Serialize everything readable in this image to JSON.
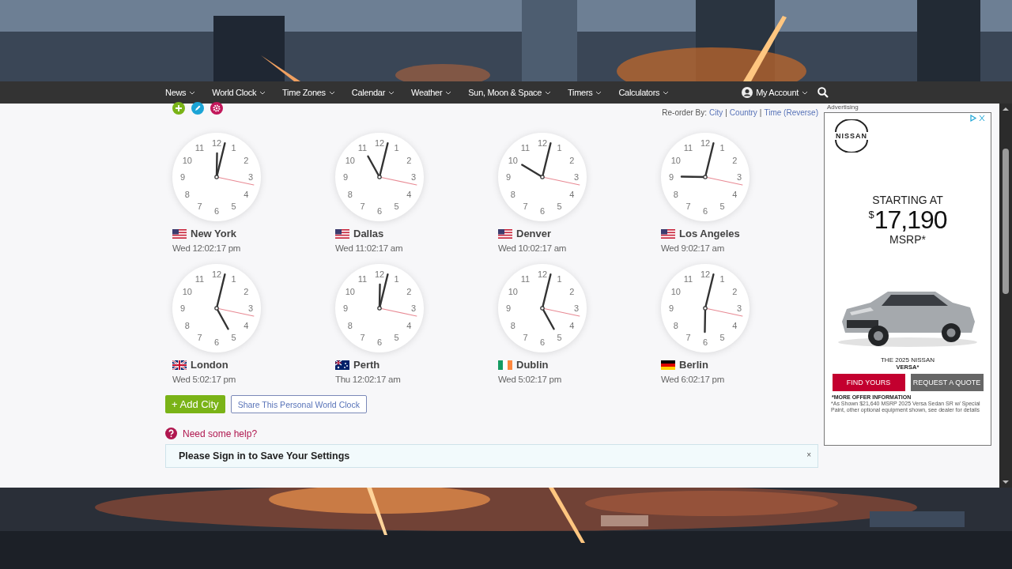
{
  "nav": {
    "items": [
      {
        "label": "News"
      },
      {
        "label": "World Clock"
      },
      {
        "label": "Time Zones"
      },
      {
        "label": "Calendar"
      },
      {
        "label": "Weather"
      },
      {
        "label": "Sun, Moon & Space"
      },
      {
        "label": "Timers"
      },
      {
        "label": "Calculators"
      }
    ],
    "account": "My Account"
  },
  "reorder": {
    "label": "Re-order By:",
    "links": [
      "City",
      "Country",
      "Time (Reverse)"
    ],
    "separator": "|"
  },
  "clocks": [
    {
      "city": "New York",
      "flag": {
        "kind": "us"
      },
      "time": "Wed 12:02:17 pm",
      "dial": [
        "12",
        "11",
        "1",
        "10",
        "2",
        "9",
        "3",
        "8",
        "4",
        "7",
        "5",
        "6"
      ]
    },
    {
      "city": "Dallas",
      "flag": {
        "kind": "us"
      },
      "time": "Wed 11:02:17 am",
      "dial": [
        "12",
        "11",
        "1",
        "10",
        "2",
        "9",
        "3",
        "8",
        "4",
        "7",
        "5",
        "6"
      ]
    },
    {
      "city": "Denver",
      "flag": {
        "kind": "us"
      },
      "time": "Wed 10:02:17 am",
      "dial": [
        "12",
        "11",
        "1",
        "10",
        "2",
        "9",
        "3",
        "8",
        "4",
        "7",
        "5",
        "6"
      ]
    },
    {
      "city": "Los Angeles",
      "flag": {
        "kind": "us"
      },
      "time": "Wed 9:02:17 am",
      "dial": [
        "12",
        "11",
        "1",
        "10",
        "2",
        "9",
        "3",
        "8",
        "4",
        "7",
        "5",
        "6"
      ]
    },
    {
      "city": "London",
      "flag": {
        "kind": "gb"
      },
      "time": "Wed 5:02:17 pm",
      "dial": [
        "12",
        "11",
        "1",
        "10",
        "2",
        "9",
        "3",
        "8",
        "4",
        "7",
        "5",
        "6"
      ]
    },
    {
      "city": "Perth",
      "flag": {
        "kind": "au"
      },
      "time": "Thu 12:02:17 am",
      "dial": [
        "12",
        "11",
        "1",
        "10",
        "2",
        "9",
        "3",
        "8",
        "4",
        "7",
        "5",
        "6"
      ]
    },
    {
      "city": "Dublin",
      "flag": {
        "kind": "ie"
      },
      "time": "Wed 5:02:17 pm",
      "dial": [
        "12",
        "11",
        "1",
        "10",
        "2",
        "9",
        "3",
        "8",
        "4",
        "7",
        "5",
        "6"
      ]
    },
    {
      "city": "Berlin",
      "flag": {
        "kind": "de"
      },
      "time": "Wed 6:02:17 pm",
      "dial": [
        "12",
        "11",
        "1",
        "10",
        "2",
        "9",
        "3",
        "8",
        "4",
        "7",
        "5",
        "6"
      ]
    }
  ],
  "buttons": {
    "add": "+ Add City",
    "share": "Share This Personal World Clock"
  },
  "help": "Need some help?",
  "notice": {
    "title": "Please Sign in to Save Your Settings",
    "close": "×"
  },
  "ad": {
    "label": "Advertising",
    "brand": "NISSAN",
    "headline": "STARTING AT",
    "currency": "$",
    "price": "17,190",
    "price_note": "MSRP*",
    "model_line": "THE 2025 NISSAN",
    "model": "VERSA*",
    "primary": "FIND YOURS",
    "secondary": "REQUEST A QUOTE",
    "offer": "*MORE OFFER INFORMATION",
    "fine_print": "*As Shown $21,640 MSRP 2025 Versa Sedan SR w/ Special Paint, other optional equipment shown, see dealer for details"
  }
}
